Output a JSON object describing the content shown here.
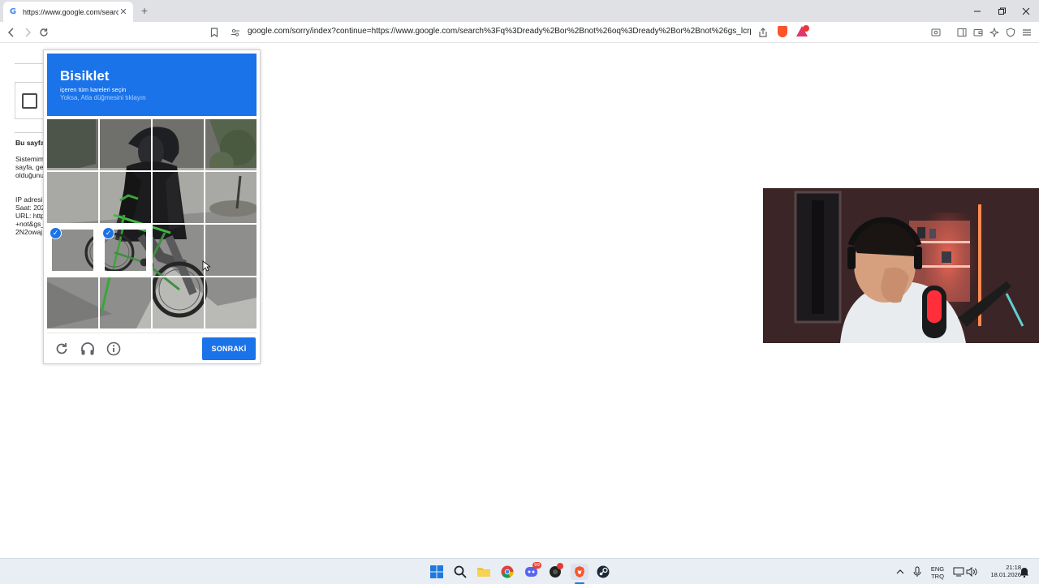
{
  "browser": {
    "tab": {
      "title": "https://www.google.com/search",
      "favicon": "google-g-icon"
    },
    "address_bar": {
      "url": "google.com/sorry/index?continue=https://www.google.com/search%3Fq%3Dready%2Bor%2Bnot%26oq%3Dready%2Bor%2Bnot%26gs_lcrp%3DEgZ..."
    }
  },
  "background_page": {
    "heading": "Bu sayfa",
    "paragraph": [
      "Sistemim",
      "sayfa, ge",
      "olduğunu"
    ],
    "details": [
      "IP adresi",
      "Saat: 202",
      "URL: http",
      "+not&gs_",
      "2N2owaj"
    ]
  },
  "captcha": {
    "title": "Bisiklet",
    "subtitle": "içeren tüm kareleri seçin",
    "hint": "Yoksa, Atla düğmesini tıklayın",
    "selected_tiles": [
      8,
      9
    ],
    "next_button": "SONRAKİ",
    "colors": {
      "accent": "#1a73e8"
    }
  },
  "taskbar": {
    "apps": [
      "windows-start-icon",
      "search-icon",
      "file-explorer-icon",
      "chrome-icon",
      "discord-icon",
      "app-icon",
      "brave-icon",
      "steam-icon"
    ],
    "discord_badge": "99",
    "language": "ENG",
    "layout": "TRQ",
    "time": "21:18",
    "date": "18.01.2026"
  }
}
